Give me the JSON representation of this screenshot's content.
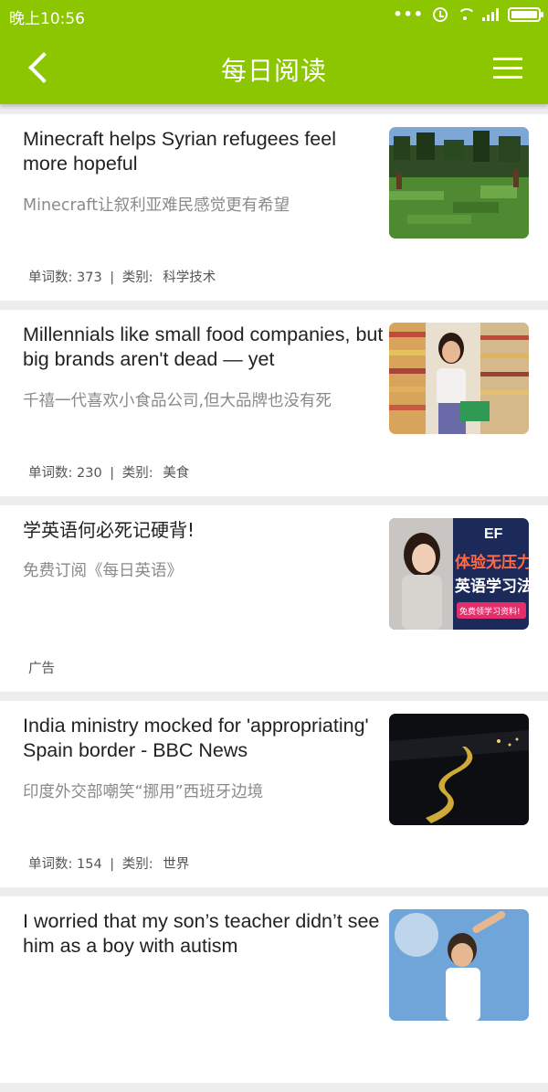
{
  "status": {
    "time": "晚上10:56",
    "dots": "•••"
  },
  "header": {
    "title": "每日阅读"
  },
  "articles": [
    {
      "title_en": "Minecraft helps Syrian refugees feel more hopeful",
      "title_cn": "Minecraft让叙利亚难民感觉更有希望",
      "words_label": "单词数:",
      "words": "373",
      "sep": "|",
      "category_label": "类别:",
      "category": "科学技术",
      "thumb": "minecraft-landscape"
    },
    {
      "title_en": "Millennials like small food companies, but big brands aren't dead — yet",
      "title_cn": "千禧一代喜欢小食品公司,但大品牌也没有死",
      "words_label": "单词数:",
      "words": "230",
      "sep": "|",
      "category_label": "类别:",
      "category": "美食",
      "thumb": "supermarket-woman"
    },
    {
      "title_en": "学英语何必死记硬背!",
      "title_cn": "免费订阅《每日英语》",
      "ad_label": "广告",
      "thumb": "ef-english-ad",
      "ad_image": {
        "brand": "EF",
        "line1": "体验无压力",
        "line2": "英语学习法",
        "cta": "免费领学习资料!"
      }
    },
    {
      "title_en": "India ministry mocked for 'appropriating' Spain border - BBC News",
      "title_cn": "印度外交部嘲笑“挪用”西班牙边境",
      "words_label": "单词数:",
      "words": "154",
      "sep": "|",
      "category_label": "类别:",
      "category": "世界",
      "thumb": "night-border-road"
    },
    {
      "title_en": "I worried that my son’s teacher didn’t see him as a boy with autism",
      "thumb": "boy-sky"
    }
  ],
  "colors": {
    "brand": "#8bc600",
    "title_text": "#222222",
    "subtitle_text": "#8a8a8a",
    "background": "#ededed"
  }
}
